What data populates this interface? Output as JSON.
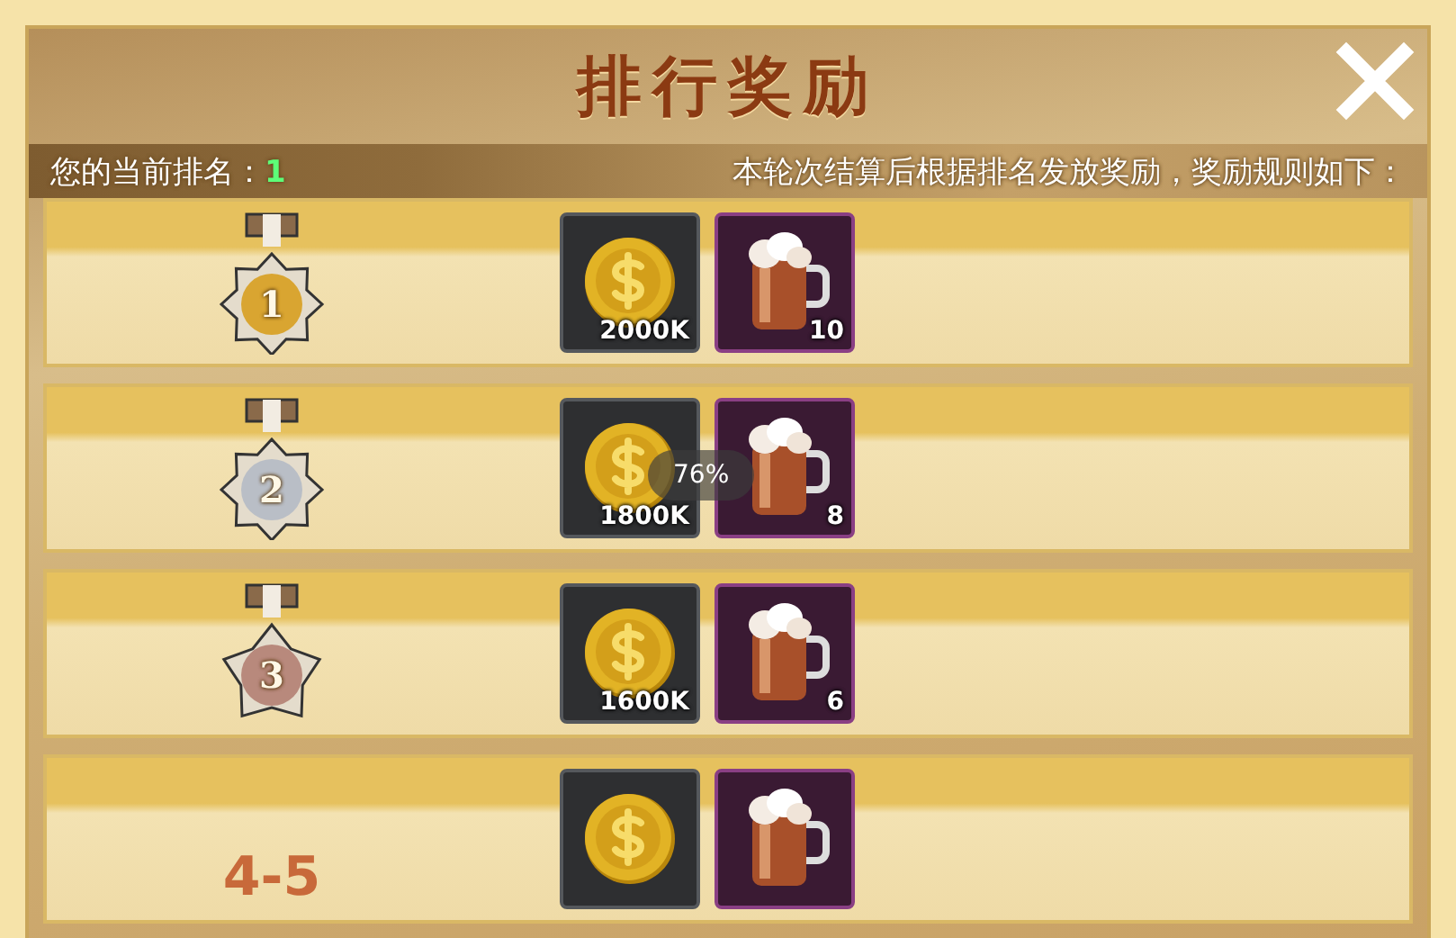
{
  "header": {
    "title": "排行奖励",
    "current_rank_label": "您的当前排名：",
    "current_rank_value": "1",
    "rules_note": "本轮次结算后根据排名发放奖励，奖励规则如下："
  },
  "rows": [
    {
      "kind": "medal",
      "color": "#d9a531",
      "label": "1",
      "rewards": [
        {
          "kind": "coin",
          "amount": "2000K"
        },
        {
          "kind": "beer",
          "amount": "10"
        }
      ]
    },
    {
      "kind": "medal",
      "color": "#b9bec6",
      "label": "2",
      "rewards": [
        {
          "kind": "coin",
          "amount": "1800K"
        },
        {
          "kind": "beer",
          "amount": "8"
        }
      ]
    },
    {
      "kind": "pentamedal",
      "color": "#b8897c",
      "label": "3",
      "rewards": [
        {
          "kind": "coin",
          "amount": "1600K"
        },
        {
          "kind": "beer",
          "amount": "6"
        }
      ]
    },
    {
      "kind": "range",
      "label": "4-5",
      "rewards": [
        {
          "kind": "coin"
        },
        {
          "kind": "beer"
        }
      ]
    }
  ],
  "zoom_indicator": "76%"
}
